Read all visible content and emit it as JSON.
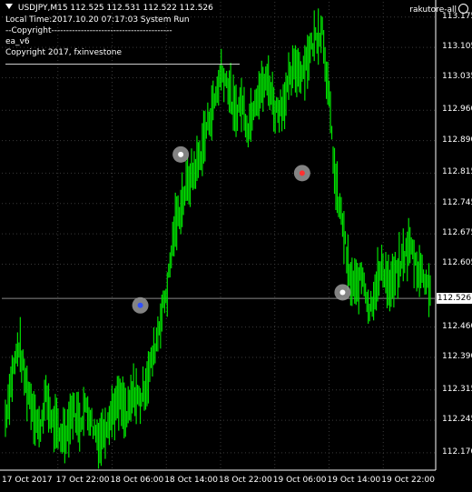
{
  "header": {
    "symbol_line": "USDJPY,M15  112.525 112.531 112.522 112.526",
    "account": "rakutore-all"
  },
  "info": {
    "local_time": "Local Time:2017.10.20 07:17:03 System Run",
    "copyright_header": "--Copyright-----------------------------------------",
    "ea_name": "ea_v6",
    "copyright": "Copyright 2017, fxinvestone"
  },
  "price_axis": {
    "labels": [
      "113.175",
      "113.105",
      "113.035",
      "112.960",
      "112.890",
      "112.815",
      "112.745",
      "112.675",
      "112.605",
      "112.460",
      "112.390",
      "112.315",
      "112.245",
      "112.170"
    ],
    "current_price": "112.526"
  },
  "time_axis": {
    "labels": [
      "17 Oct 2017",
      "17 Oct 22:00",
      "18 Oct 06:00",
      "18 Oct 14:00",
      "18 Oct 22:00",
      "19 Oct 06:00",
      "19 Oct 14:00",
      "19 Oct 22:00"
    ]
  },
  "colors": {
    "background": "#000000",
    "candles": "#00e000",
    "grid": "#3a3a3a",
    "text": "#ffffff",
    "sell_marker": "#ff3030",
    "buy_marker": "#3050ff"
  },
  "chart_data": {
    "type": "line",
    "title": "",
    "xlabel": "",
    "ylabel": "",
    "ylim": [
      112.13,
      113.21
    ],
    "x": [
      "17 Oct 2017",
      "17 Oct 22:00",
      "18 Oct 06:00",
      "18 Oct 14:00",
      "18 Oct 22:00",
      "19 Oct 06:00",
      "19 Oct 14:00",
      "19 Oct 22:00"
    ],
    "series": [
      {
        "values": [
          112.25,
          112.35,
          112.42,
          112.33,
          112.28,
          112.22,
          112.3,
          112.24,
          112.21,
          112.22,
          112.27,
          112.24,
          112.28,
          112.23,
          112.2,
          112.24,
          112.27,
          112.29,
          112.25,
          112.31,
          112.29,
          112.34,
          112.4,
          112.48,
          112.55,
          112.68,
          112.74,
          112.79,
          112.82,
          112.86,
          112.93,
          112.98,
          113.05,
          113.02,
          112.95,
          112.98,
          112.92,
          112.99,
          113.01,
          113.03,
          112.96,
          112.97,
          113.02,
          113.06,
          113.05,
          113.09,
          113.13,
          113.15,
          112.98,
          112.78,
          112.7,
          112.57,
          112.55,
          112.58,
          112.5,
          112.56,
          112.6,
          112.55,
          112.58,
          112.62,
          112.65,
          112.6,
          112.58,
          112.55
        ]
      }
    ],
    "markers": [
      {
        "x_index": 26,
        "price": 112.858,
        "kind": "entry"
      },
      {
        "x_index": 20,
        "price": 112.51,
        "kind": "buy"
      },
      {
        "x_index": 44,
        "price": 112.815,
        "kind": "sell"
      },
      {
        "x_index": 50,
        "price": 112.54,
        "kind": "exit"
      }
    ]
  }
}
